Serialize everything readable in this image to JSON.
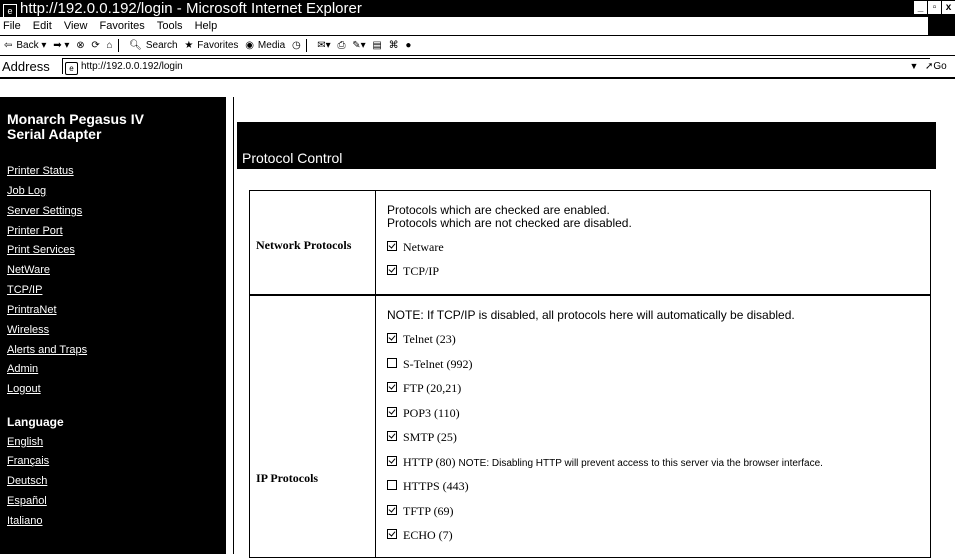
{
  "window": {
    "title": "http://192.0.0.192/login - Microsoft Internet Explorer"
  },
  "menu": [
    "File",
    "Edit",
    "View",
    "Favorites",
    "Tools",
    "Help"
  ],
  "toolbar": {
    "back": "Back",
    "search": "Search",
    "favorites": "Favorites",
    "media": "Media"
  },
  "address": {
    "label": "Address",
    "url": "http://192.0.0.192/login",
    "go": "Go"
  },
  "sidebar": {
    "title_line1": "Monarch Pegasus IV",
    "title_line2": "Serial Adapter",
    "links": [
      "Printer Status",
      "Job Log",
      "Server Settings",
      "Printer Port",
      "Print Services",
      "NetWare",
      "TCP/IP",
      "PrintraNet",
      "Wireless",
      "Alerts and Traps",
      "Admin",
      "Logout"
    ],
    "language_heading": "Language",
    "languages": [
      "English",
      "Français",
      "Deutsch",
      "Español",
      "Italiano"
    ]
  },
  "page": {
    "title": "Protocol Control"
  },
  "network": {
    "label": "Network Protocols",
    "line1": "Protocols which are checked are enabled.",
    "line2": "Protocols which are not checked are disabled.",
    "items": [
      {
        "label": "Netware",
        "checked": true
      },
      {
        "label": "TCP/IP",
        "checked": true
      }
    ]
  },
  "ip": {
    "label": "IP Protocols",
    "note": "NOTE: If TCP/IP is disabled, all protocols here will automatically be disabled.",
    "items": [
      {
        "label": "Telnet (23)",
        "checked": true
      },
      {
        "label": "S-Telnet (992)",
        "checked": false
      },
      {
        "label": "FTP (20,21)",
        "checked": true
      },
      {
        "label": "POP3 (110)",
        "checked": true
      },
      {
        "label": "SMTP (25)",
        "checked": true
      },
      {
        "label": "HTTP (80)",
        "checked": true
      },
      {
        "label": "HTTPS (443)",
        "checked": false
      },
      {
        "label": "TFTP (69)",
        "checked": true
      },
      {
        "label": "ECHO (7)",
        "checked": true
      }
    ],
    "http_note": "NOTE: Disabling HTTP will prevent access to this server via the browser interface."
  }
}
